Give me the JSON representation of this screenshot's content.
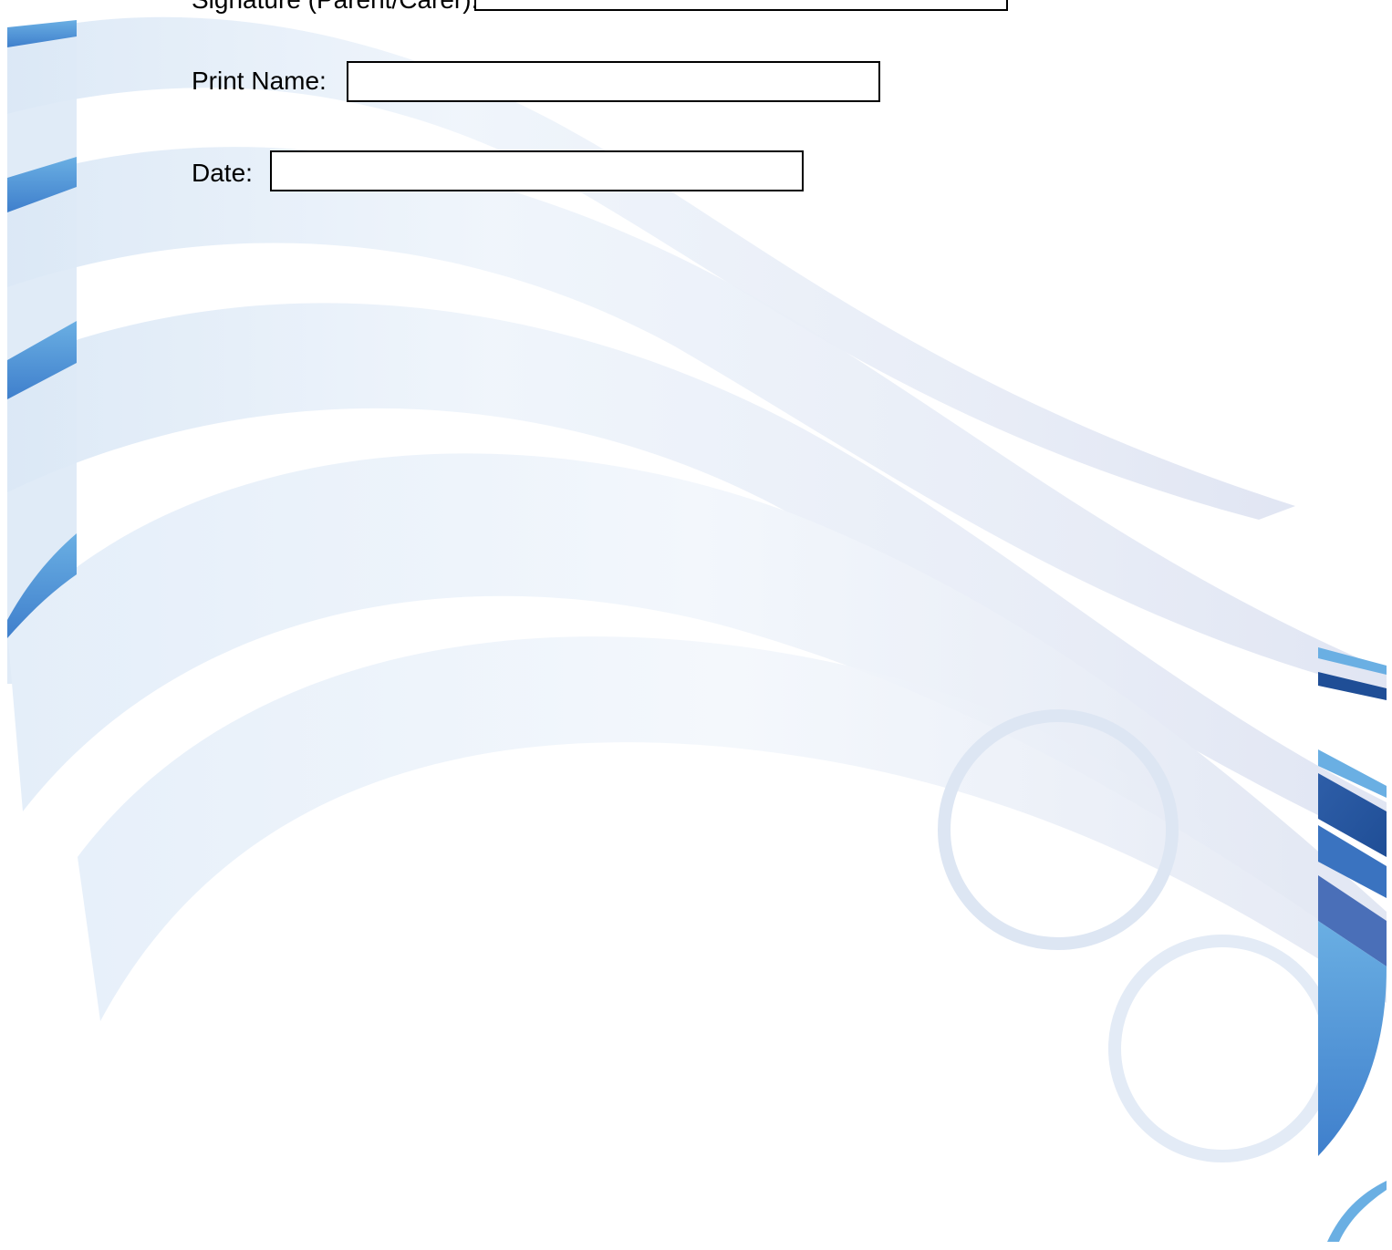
{
  "form": {
    "signature": {
      "label": "Signature (Parent/Carer):",
      "value": ""
    },
    "print_name": {
      "label": "Print Name:",
      "value": ""
    },
    "date": {
      "label": "Date:",
      "value": ""
    }
  },
  "colors": {
    "accent_light": "#6aafe3",
    "accent_dark": "#1f4e96",
    "ribbon_pale": "#dbe8f6",
    "ribbon_lilac": "#d8ddee",
    "text": "#000000"
  }
}
